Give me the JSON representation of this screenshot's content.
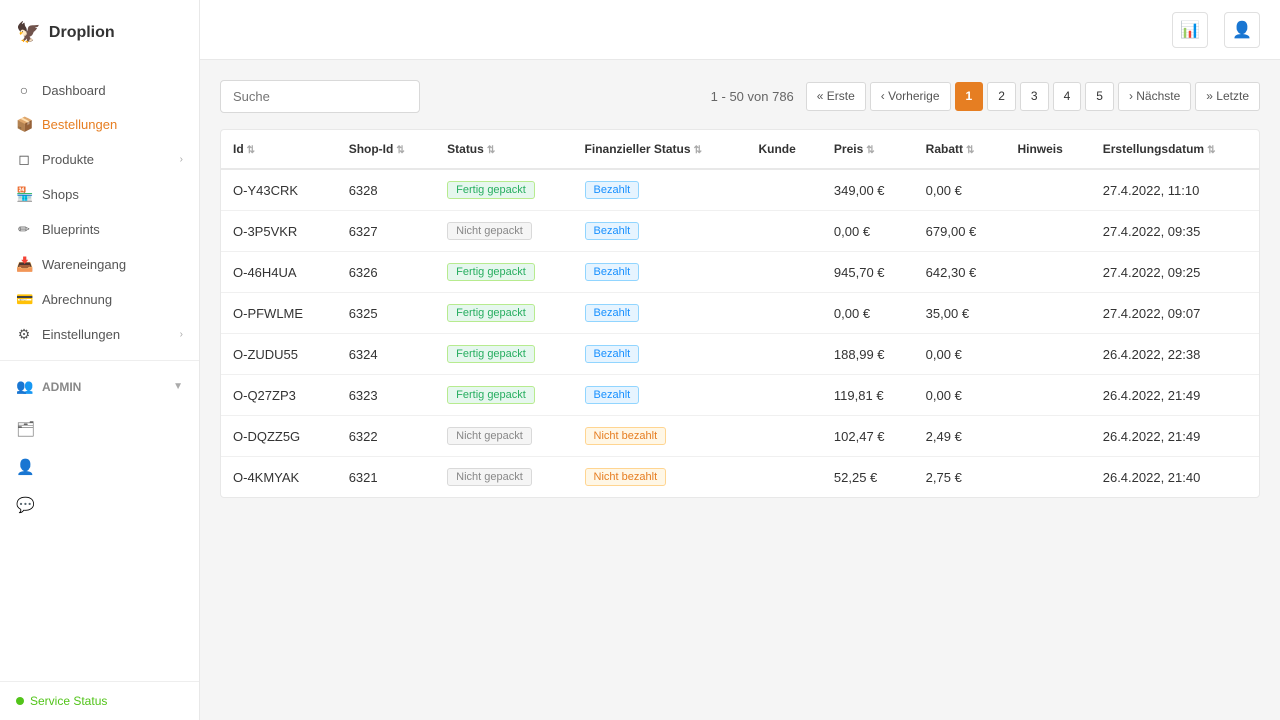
{
  "app": {
    "name": "Droplion",
    "logo_icon": "🦅"
  },
  "sidebar": {
    "nav_items": [
      {
        "id": "dashboard",
        "label": "Dashboard",
        "icon": "○",
        "active": false,
        "has_arrow": false
      },
      {
        "id": "bestellungen",
        "label": "Bestellungen",
        "icon": "📦",
        "active": true,
        "has_arrow": false
      },
      {
        "id": "produkte",
        "label": "Produkte",
        "icon": "◻",
        "active": false,
        "has_arrow": true
      },
      {
        "id": "shops",
        "label": "Shops",
        "icon": "🏪",
        "active": false,
        "has_arrow": false
      },
      {
        "id": "blueprints",
        "label": "Blueprints",
        "icon": "✏",
        "active": false,
        "has_arrow": false
      },
      {
        "id": "wareneingang",
        "label": "Wareneingang",
        "icon": "📥",
        "active": false,
        "has_arrow": false
      },
      {
        "id": "abrechnung",
        "label": "Abrechnung",
        "icon": "💳",
        "active": false,
        "has_arrow": false
      },
      {
        "id": "einstellungen",
        "label": "Einstellungen",
        "icon": "⚙",
        "active": false,
        "has_arrow": true
      }
    ],
    "admin_section": {
      "label": "Admin",
      "icons": [
        "🗂",
        "👤",
        "💬"
      ]
    },
    "footer": {
      "status_label": "Service Status",
      "status_color": "#52c41a"
    }
  },
  "header": {
    "chart_icon": "📊",
    "user_icon": "👤"
  },
  "toolbar": {
    "search_placeholder": "Suche",
    "pagination_info": "1 - 50 von 786",
    "buttons": {
      "first": "« Erste",
      "prev": "‹ Vorherige",
      "next": "› Nächste",
      "last": "» Letzte"
    },
    "pages": [
      "1",
      "2",
      "3",
      "4",
      "5"
    ],
    "active_page": "1"
  },
  "table": {
    "columns": [
      {
        "id": "id",
        "label": "Id",
        "sortable": true
      },
      {
        "id": "shop_id",
        "label": "Shop-Id",
        "sortable": true
      },
      {
        "id": "status",
        "label": "Status",
        "sortable": true
      },
      {
        "id": "fin_status",
        "label": "Finanzieller Status",
        "sortable": true
      },
      {
        "id": "kunde",
        "label": "Kunde",
        "sortable": false
      },
      {
        "id": "preis",
        "label": "Preis",
        "sortable": true
      },
      {
        "id": "rabatt",
        "label": "Rabatt",
        "sortable": true
      },
      {
        "id": "hinweis",
        "label": "Hinweis",
        "sortable": false
      },
      {
        "id": "erstellungsdatum",
        "label": "Erstellungsdatum",
        "sortable": true
      }
    ],
    "rows": [
      {
        "id": "O-Y43CRK",
        "shop_id": "6328",
        "status": "Fertig gepackt",
        "status_type": "green",
        "fin_status": "Bezahlt",
        "fin_type": "blue",
        "kunde": "",
        "preis": "349,00 €",
        "rabatt": "0,00 €",
        "hinweis": "",
        "datum": "27.4.2022, 11:10"
      },
      {
        "id": "O-3P5VKR",
        "shop_id": "6327",
        "status": "Nicht gepackt",
        "status_type": "gray",
        "fin_status": "Bezahlt",
        "fin_type": "blue",
        "kunde": "",
        "preis": "0,00 €",
        "rabatt": "679,00 €",
        "hinweis": "",
        "datum": "27.4.2022, 09:35"
      },
      {
        "id": "O-46H4UA",
        "shop_id": "6326",
        "status": "Fertig gepackt",
        "status_type": "green",
        "fin_status": "Bezahlt",
        "fin_type": "blue",
        "kunde": "",
        "preis": "945,70 €",
        "rabatt": "642,30 €",
        "hinweis": "",
        "datum": "27.4.2022, 09:25"
      },
      {
        "id": "O-PFWLME",
        "shop_id": "6325",
        "status": "Fertig gepackt",
        "status_type": "green",
        "fin_status": "Bezahlt",
        "fin_type": "blue",
        "kunde": "",
        "preis": "0,00 €",
        "rabatt": "35,00 €",
        "hinweis": "",
        "datum": "27.4.2022, 09:07"
      },
      {
        "id": "O-ZUDU55",
        "shop_id": "6324",
        "status": "Fertig gepackt",
        "status_type": "green",
        "fin_status": "Bezahlt",
        "fin_type": "blue",
        "kunde": "",
        "preis": "188,99 €",
        "rabatt": "0,00 €",
        "hinweis": "",
        "datum": "26.4.2022, 22:38"
      },
      {
        "id": "O-Q27ZP3",
        "shop_id": "6323",
        "status": "Fertig gepackt",
        "status_type": "green",
        "fin_status": "Bezahlt",
        "fin_type": "blue",
        "kunde": "",
        "preis": "119,81 €",
        "rabatt": "0,00 €",
        "hinweis": "",
        "datum": "26.4.2022, 21:49"
      },
      {
        "id": "O-DQZZ5G",
        "shop_id": "6322",
        "status": "Nicht gepackt",
        "status_type": "gray",
        "fin_status": "Nicht bezahlt",
        "fin_type": "orange",
        "kunde": "",
        "preis": "102,47 €",
        "rabatt": "2,49 €",
        "hinweis": "",
        "datum": "26.4.2022, 21:49"
      },
      {
        "id": "O-4KMYAK",
        "shop_id": "6321",
        "status": "Nicht gepackt",
        "status_type": "gray",
        "fin_status": "Nicht bezahlt",
        "fin_type": "orange",
        "kunde": "",
        "preis": "52,25 €",
        "rabatt": "2,75 €",
        "hinweis": "",
        "datum": "26.4.2022, 21:40"
      }
    ]
  }
}
